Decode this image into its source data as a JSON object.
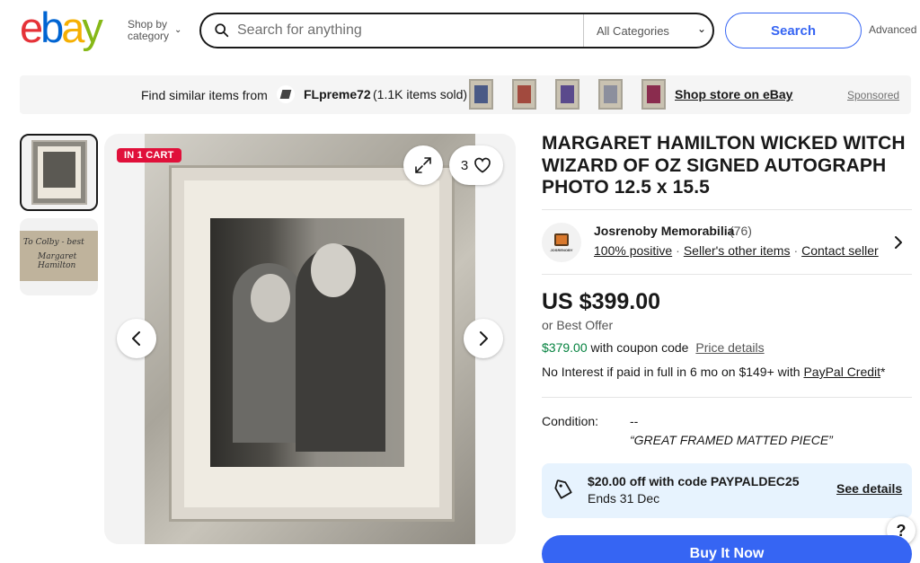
{
  "header": {
    "logo": [
      "e",
      "b",
      "a",
      "y"
    ],
    "logo_colors": [
      "#e53238",
      "#0064d2",
      "#f5af02",
      "#86b817"
    ],
    "shop_by_line1": "Shop by",
    "shop_by_line2": "category",
    "search_placeholder": "Search for anything",
    "category_select": "All Categories",
    "search_button": "Search",
    "advanced": "Advanced"
  },
  "banner": {
    "find_similar": "Find similar items from",
    "store_name": "FLpreme72",
    "items_sold": "(1.1K items sold)",
    "shop_store": "Shop store on eBay",
    "sponsored": "Sponsored"
  },
  "gallery": {
    "badge": "IN 1 CART",
    "watch_count": "3",
    "signature_text": "To Colby - Best wishes Margaret Hamilton"
  },
  "listing": {
    "title": "MARGARET HAMILTON WICKED WITCH WIZARD OF OZ SIGNED AUTOGRAPH PHOTO 12.5 x 15.5",
    "seller": {
      "name": "Josrenoby Memorabilia",
      "feedback_count": "(76)",
      "positive": "100% positive",
      "other_items": "Seller's other items",
      "contact": "Contact seller",
      "avatar_label": "JOSRENOBY"
    },
    "price": "US $399.00",
    "best_offer": "or Best Offer",
    "coupon_price": "$379.00",
    "coupon_text": "with coupon code",
    "price_details": "Price details",
    "paypal_text": "No Interest if paid in full in 6 mo on $149+ with",
    "paypal_link": "PayPal Credit",
    "paypal_suffix": "*",
    "condition_label": "Condition:",
    "condition_value": "--",
    "condition_note": "“GREAT FRAMED MATTED PIECE”",
    "promo_line1": "$20.00 off with code PAYPALDEC25",
    "promo_line2": "Ends 31 Dec",
    "promo_link": "See details",
    "buy_now": "Buy It Now",
    "help": "?"
  }
}
